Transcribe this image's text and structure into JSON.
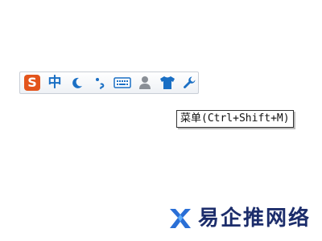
{
  "toolbar": {
    "logo_glyph": "S",
    "mode_label": "中",
    "icons": [
      "sogou-logo-icon",
      "chinese-mode-icon",
      "moon-fullwidth-icon",
      "punctuation-icon",
      "keyboard-icon",
      "user-icon",
      "skin-shirt-icon",
      "wrench-menu-icon"
    ]
  },
  "tooltip": {
    "text": "菜单(Ctrl+Shift+M)"
  },
  "watermark": {
    "text": "易企推网络"
  },
  "colors": {
    "logo": "#e3541b",
    "accent": "#1a6fc4",
    "toolbar_border": "#c9ced6",
    "watermark": "#1c2d6b"
  }
}
